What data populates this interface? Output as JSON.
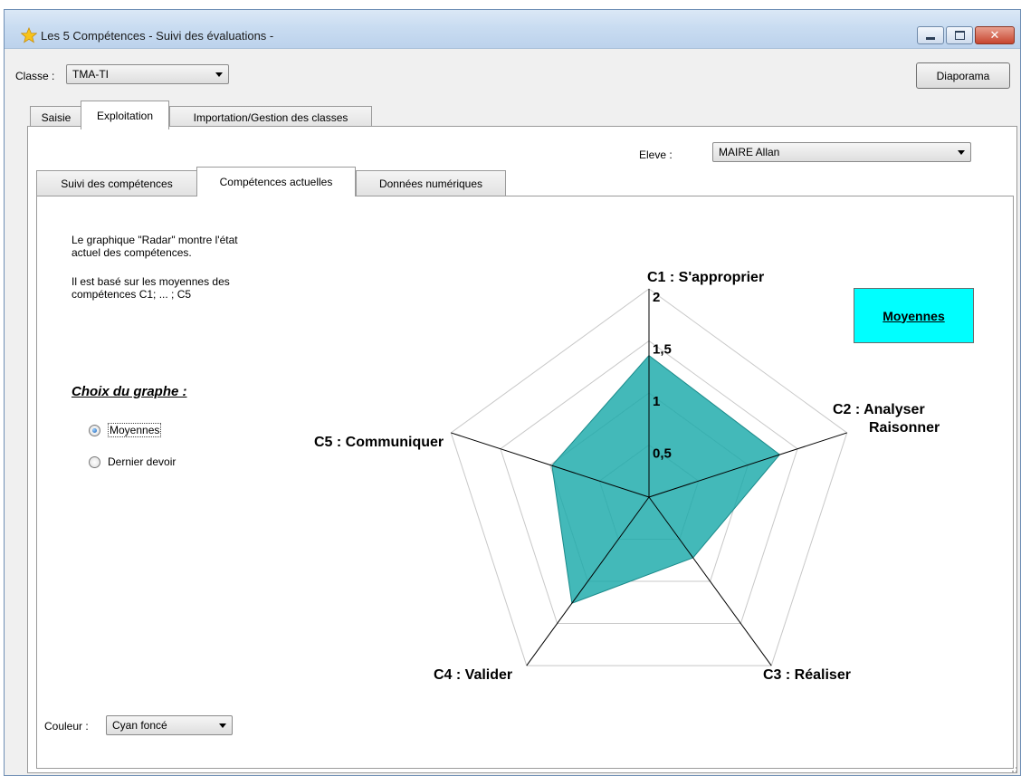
{
  "window": {
    "title": "Les 5 Compétences - Suivi des évaluations -",
    "icon": "star-icon"
  },
  "toolbar": {
    "classe_label": "Classe :",
    "classe_value": "TMA-TI",
    "diaporama_label": "Diaporama"
  },
  "main_tabs": [
    {
      "label": "Saisie"
    },
    {
      "label": "Exploitation"
    },
    {
      "label": "Importation/Gestion des classes"
    }
  ],
  "eleve": {
    "label": "Eleve :",
    "value": "MAIRE Allan"
  },
  "sub_tabs": [
    {
      "label": "Suivi des compétences"
    },
    {
      "label": "Compétences actuelles"
    },
    {
      "label": "Données numériques"
    }
  ],
  "description": {
    "line1": "Le graphique \"Radar\" montre l'état",
    "line2": "actuel des compétences.",
    "line3": "Il est basé sur les moyennes des",
    "line4": "compétences C1; ... ; C5"
  },
  "choix": {
    "title": "Choix du graphe :",
    "options": [
      {
        "label": "Moyennes",
        "selected": true
      },
      {
        "label": "Dernier devoir",
        "selected": false
      }
    ]
  },
  "badge_label": "Moyennes",
  "couleur": {
    "label": "Couleur :",
    "value": "Cyan foncé"
  },
  "colors": {
    "fill": "#1aa9a9",
    "stroke": "#1a8a8a",
    "badge": "#00ffff",
    "grid": "#c8c8c8",
    "axis": "#000000"
  },
  "chart_data": {
    "type": "radar",
    "axes": [
      "C1 : S'approprier",
      "C2 : Analyser Raisonner",
      "C3 : Réaliser",
      "C4 : Valider",
      "C5 : Communiquer"
    ],
    "axis_label_lines": [
      [
        "C1 : S'approprier"
      ],
      [
        "C2 : Analyser",
        "Raisonner"
      ],
      [
        "C3 : Réaliser"
      ],
      [
        "C4 : Valider"
      ],
      [
        "C5 : Communiquer"
      ]
    ],
    "range": [
      0,
      2
    ],
    "ticks": [
      "0,5",
      "1",
      "1,5",
      "2"
    ],
    "tick_values": [
      0.5,
      1,
      1.5,
      2
    ],
    "series": [
      {
        "values": [
          1.36,
          1.32,
          0.72,
          1.26,
          0.98
        ]
      }
    ],
    "grid": true
  }
}
